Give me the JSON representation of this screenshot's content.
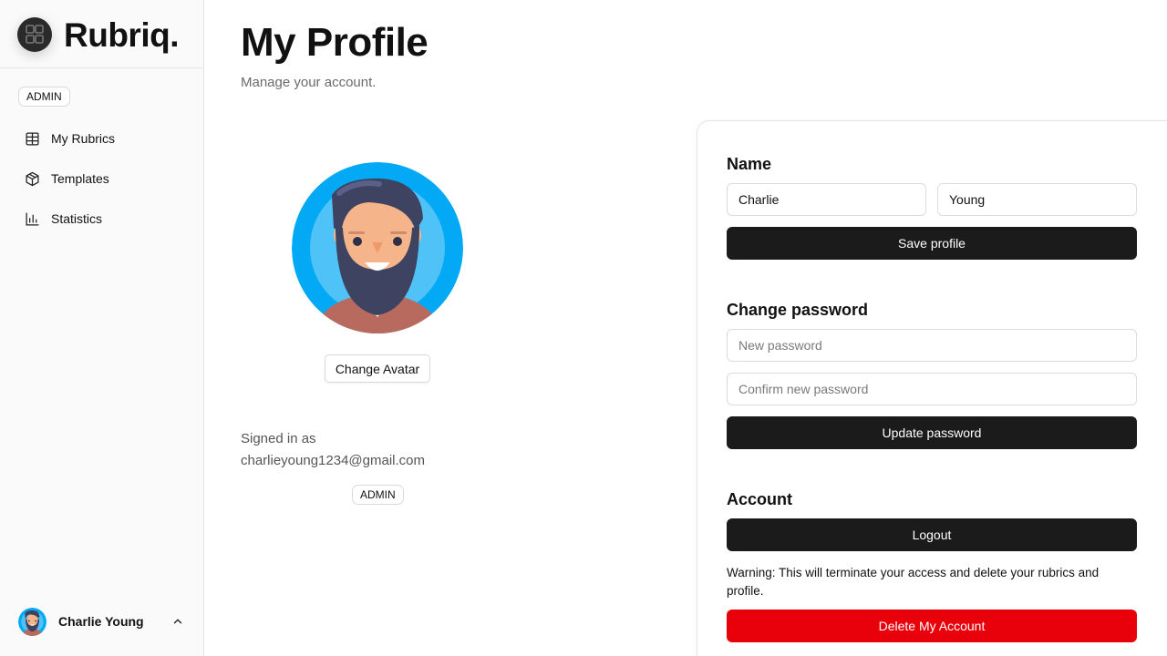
{
  "brand": {
    "name": "Rubriq."
  },
  "sidebar": {
    "role_badge": "ADMIN",
    "items": [
      {
        "label": "My Rubrics",
        "icon": "table-icon"
      },
      {
        "label": "Templates",
        "icon": "package-icon"
      },
      {
        "label": "Statistics",
        "icon": "bar-chart-icon"
      }
    ],
    "user": {
      "name": "Charlie Young",
      "icon": "chevron-up-icon"
    }
  },
  "header": {
    "title": "My Profile",
    "subtitle": "Manage your account."
  },
  "profile": {
    "change_avatar_label": "Change Avatar",
    "signed_in_label": "Signed in as",
    "email": "charlieyoung1234@gmail.com",
    "role_badge": "ADMIN"
  },
  "name_section": {
    "title": "Name",
    "first_name": "Charlie",
    "last_name": "Young",
    "save_label": "Save profile"
  },
  "password_section": {
    "title": "Change password",
    "new_placeholder": "New password",
    "confirm_placeholder": "Confirm new password",
    "update_label": "Update password"
  },
  "account_section": {
    "title": "Account",
    "logout_label": "Logout",
    "warning": "Warning: This will terminate your access and delete your rubrics and profile.",
    "delete_label": "Delete My Account"
  },
  "colors": {
    "accent_dark": "#1b1b1b",
    "danger": "#e8000b",
    "avatar_ring": "#03a9f4"
  }
}
